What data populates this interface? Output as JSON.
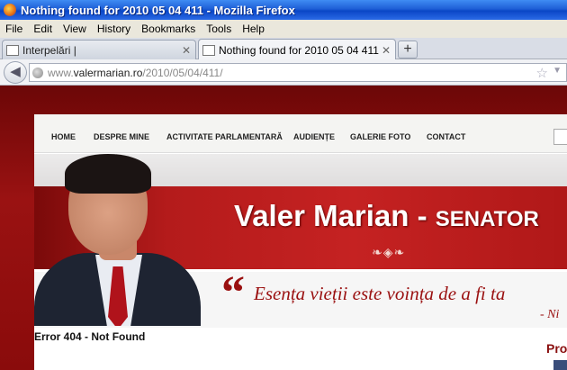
{
  "window": {
    "title": "Nothing found for 2010 05 04 411 - Mozilla Firefox"
  },
  "menu": [
    "File",
    "Edit",
    "View",
    "History",
    "Bookmarks",
    "Tools",
    "Help"
  ],
  "tabs": [
    {
      "label": "Interpelări |",
      "active": false
    },
    {
      "label": "Nothing found for 2010 05 04 411",
      "active": true
    }
  ],
  "newtab": "+",
  "address": {
    "host_prefix": "www.",
    "host": "valermarian.ro",
    "path": "/2010/05/04/411/"
  },
  "site": {
    "nav": [
      "HOME",
      "DESPRE MINE",
      "ACTIVITATE PARLAMENTARĂ",
      "AUDIENȚE",
      "GALERIE FOTO",
      "CONTACT"
    ],
    "banner_name": "Valer Marian - ",
    "banner_title": "SENATOR",
    "ornament": "❧◈❧",
    "quote_mark": "“",
    "quote": "Esența vieții este voința de a fi ta",
    "quote_author": "- Ni",
    "error": "Error 404 - Not Found",
    "sidebar_heading": "Pro"
  },
  "colors": {
    "accent": "#9a1010",
    "titlebar": "#1e5fd6"
  }
}
